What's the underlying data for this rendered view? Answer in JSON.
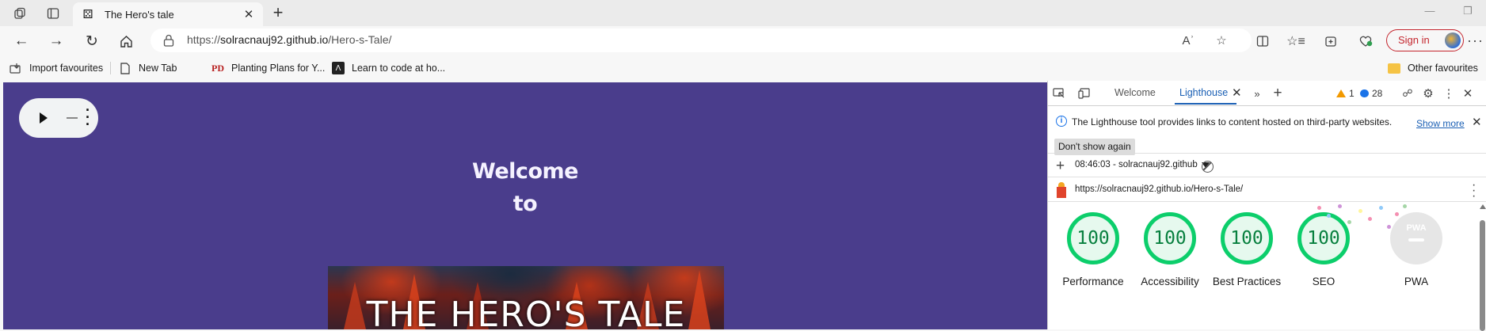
{
  "browser": {
    "tab": {
      "title": "The Hero's tale",
      "favicon": "dice-icon"
    },
    "address": {
      "scheme": "https://",
      "domain": "solracnauj92.github.io",
      "path": "/Hero-s-Tale/"
    },
    "sign_in_label": "Sign in",
    "favourites": [
      {
        "label": "Import favourites",
        "icon": "import-icon"
      },
      {
        "label": "New Tab",
        "icon": "page-icon"
      },
      {
        "label": "Planting Plans for Y...",
        "icon": "PD"
      },
      {
        "label": "Learn to code at ho...",
        "icon": "code-icon"
      }
    ],
    "other_favourites": "Other favourites"
  },
  "page": {
    "welcome_line1": "Welcome",
    "welcome_line2": "to",
    "hero_title": "THE HERO'S TALE"
  },
  "devtools": {
    "tabs": [
      "Welcome",
      "Lighthouse"
    ],
    "active_tab": "Lighthouse",
    "warnings_count": "1",
    "messages_count": "28",
    "info_message": "The Lighthouse tool provides links to content hosted on third-party websites.",
    "show_more": "Show more",
    "dont_show_again": "Don't show again",
    "report_select": "08:46:03 - solracnauj92.github",
    "report_url": "https://solracnauj92.github.io/Hero-s-Tale/",
    "scores": [
      {
        "label": "Performance",
        "value": "100"
      },
      {
        "label": "Accessibility",
        "value": "100"
      },
      {
        "label": "Best Practices",
        "value": "100"
      },
      {
        "label": "SEO",
        "value": "100"
      }
    ],
    "pwa_label": "PWA",
    "pwa_badge": "PWA",
    "score_color": "#0cce6b"
  }
}
